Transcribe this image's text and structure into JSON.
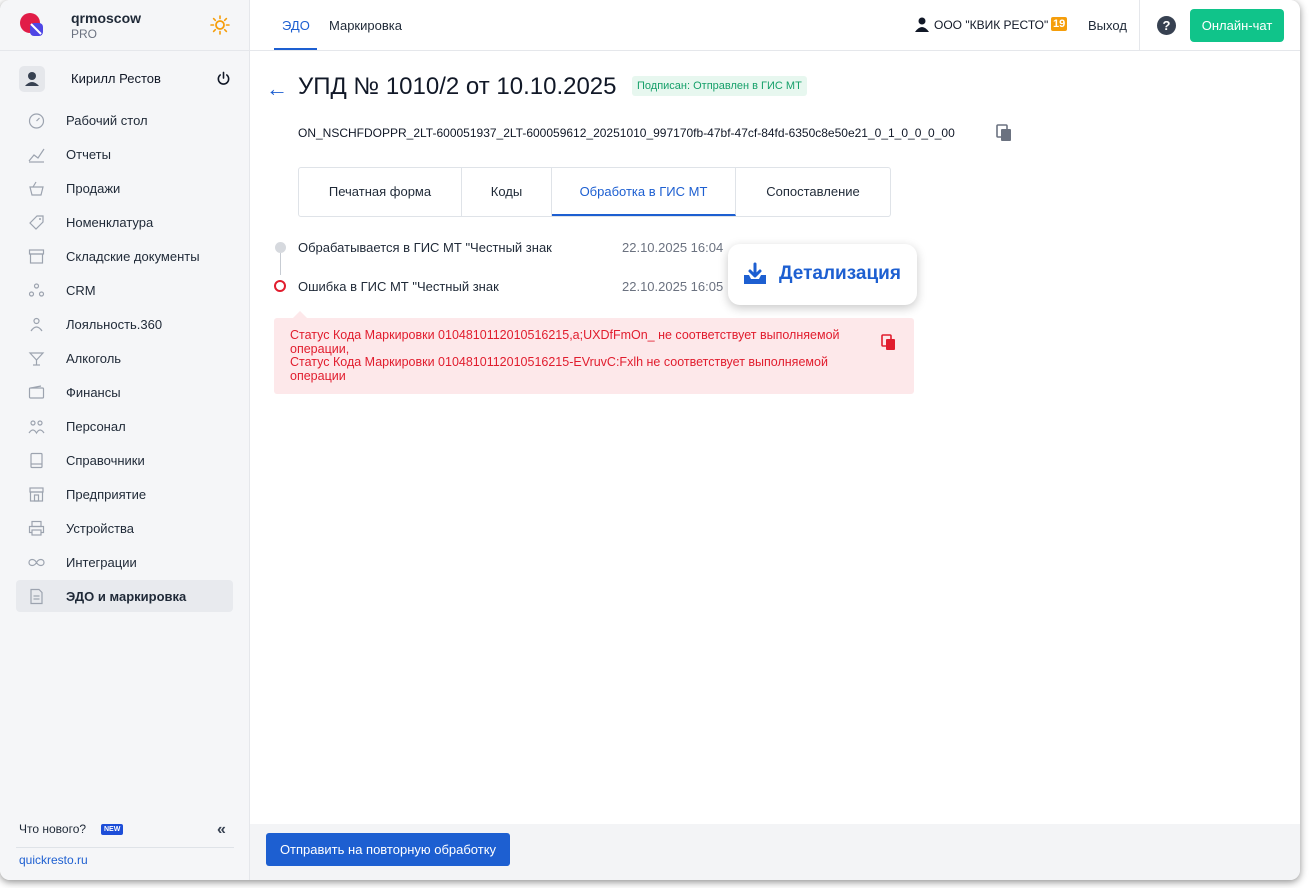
{
  "brand": {
    "name": "qrmoscow",
    "plan": "PRO"
  },
  "user": {
    "name": "Кирилл Рестов"
  },
  "sidebar": {
    "items": [
      {
        "label": "Рабочий стол",
        "icon": "dashboard-icon"
      },
      {
        "label": "Отчеты",
        "icon": "chart-icon"
      },
      {
        "label": "Продажи",
        "icon": "basket-icon"
      },
      {
        "label": "Номенклатура",
        "icon": "tag-icon"
      },
      {
        "label": "Складские документы",
        "icon": "archive-icon"
      },
      {
        "label": "CRM",
        "icon": "people-icon"
      },
      {
        "label": "Лояльность.360",
        "icon": "loyalty-icon"
      },
      {
        "label": "Алкоголь",
        "icon": "cocktail-icon"
      },
      {
        "label": "Финансы",
        "icon": "wallet-icon"
      },
      {
        "label": "Персонал",
        "icon": "staff-icon"
      },
      {
        "label": "Справочники",
        "icon": "book-icon"
      },
      {
        "label": "Предприятие",
        "icon": "store-icon"
      },
      {
        "label": "Устройства",
        "icon": "printer-icon"
      },
      {
        "label": "Интеграции",
        "icon": "infinity-icon"
      },
      {
        "label": "ЭДО и маркировка",
        "icon": "document-icon",
        "active": true
      }
    ],
    "whats_new": "Что нового?",
    "new_badge": "NEW",
    "site_link": "quickresto.ru"
  },
  "topbar": {
    "tabs": [
      {
        "label": "ЭДО",
        "active": true
      },
      {
        "label": "Маркировка"
      }
    ],
    "org": "ООО \"КВИК РЕСТО\"",
    "org_badge": "19",
    "logout": "Выход",
    "help": "?",
    "chat": "Онлайн-чат"
  },
  "document": {
    "title": "УПД № 1010/2 от 10.10.2025",
    "status": "Подписан: Отправлен в ГИС МТ",
    "filename": "ON_NSCHFDOPPR_2LT-600051937_2LT-600059612_20251010_997170fb-47bf-47cf-84fd-6350c8e50e21_0_1_0_0_0_00"
  },
  "tabs": [
    {
      "label": "Печатная форма"
    },
    {
      "label": "Коды"
    },
    {
      "label": "Обработка в ГИС МТ",
      "active": true
    },
    {
      "label": "Сопоставление"
    }
  ],
  "timeline": [
    {
      "label": "Обрабатывается в ГИС МТ \"Честный знак",
      "time": "22.10.2025 16:04",
      "state": "done"
    },
    {
      "label": "Ошибка в ГИС МТ \"Честный знак",
      "time": "22.10.2025 16:05",
      "state": "error"
    }
  ],
  "detail_button": "Детализация",
  "error_message": "Статус Кода Маркировки 0104810112010516215,a;UXDfFmOn_ не соответствует выполняемой операции,\nСтатус Кода Маркировки 0104810112010516215-EVruvC:Fxlh не соответствует выполняемой операции",
  "footer": {
    "resend_button": "Отправить на повторную обработку"
  },
  "colors": {
    "accent": "#1d5fd1",
    "success": "#10c48a",
    "error": "#e11d2e",
    "badge": "#f59e0b"
  }
}
